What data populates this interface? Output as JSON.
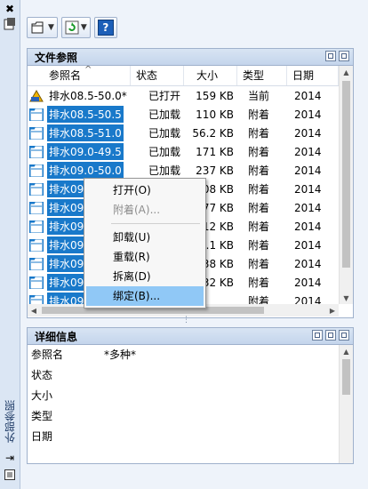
{
  "palette": {
    "title": "外部参照"
  },
  "file_refs": {
    "title": "文件参照",
    "columns": [
      "参照名",
      "状态",
      "大小",
      "类型",
      "日期"
    ],
    "rows": [
      {
        "name": "排水08.5-50.0*",
        "status": "已打开",
        "size": "159 KB",
        "type": "当前",
        "date": "2014",
        "selected": false,
        "icon": "dwg-current-icon"
      },
      {
        "name": "排水08.5-50.5",
        "status": "已加载",
        "size": "110 KB",
        "type": "附着",
        "date": "2014",
        "selected": true,
        "icon": "xref-icon"
      },
      {
        "name": "排水08.5-51.0",
        "status": "已加载",
        "size": "56.2 KB",
        "type": "附着",
        "date": "2014",
        "selected": true,
        "icon": "xref-icon"
      },
      {
        "name": "排水09.0-49.5",
        "status": "已加载",
        "size": "171 KB",
        "type": "附着",
        "date": "2014",
        "selected": true,
        "icon": "xref-icon"
      },
      {
        "name": "排水09.0-50.0",
        "status": "已加载",
        "size": "237 KB",
        "type": "附着",
        "date": "2014",
        "selected": true,
        "icon": "xref-icon"
      },
      {
        "name": "排水09",
        "status": "",
        "size": "08 KB",
        "type": "附着",
        "date": "2014",
        "selected": true,
        "icon": "xref-icon"
      },
      {
        "name": "排水09",
        "status": "",
        "size": "77 KB",
        "type": "附着",
        "date": "2014",
        "selected": true,
        "icon": "xref-icon"
      },
      {
        "name": "排水09",
        "status": "",
        "size": "12 KB",
        "type": "附着",
        "date": "2014",
        "selected": true,
        "icon": "xref-icon"
      },
      {
        "name": "排水09",
        "status": "",
        "size": "0.1 KB",
        "type": "附着",
        "date": "2014",
        "selected": true,
        "icon": "xref-icon"
      },
      {
        "name": "排水09",
        "status": "",
        "size": "38 KB",
        "type": "附着",
        "date": "2014",
        "selected": true,
        "icon": "xref-icon"
      },
      {
        "name": "排水09",
        "status": "",
        "size": "32 KB",
        "type": "附着",
        "date": "2014",
        "selected": true,
        "icon": "xref-icon"
      },
      {
        "name": "排水09",
        "status": "",
        "size": "",
        "type": "附着",
        "date": "2014",
        "selected": true,
        "icon": "xref-icon"
      }
    ]
  },
  "context_menu": {
    "items": [
      {
        "label": "打开(O)",
        "disabled": false,
        "hover": false
      },
      {
        "label": "附着(A)...",
        "disabled": true,
        "hover": false
      },
      {
        "sep": true
      },
      {
        "label": "卸载(U)",
        "disabled": false,
        "hover": false
      },
      {
        "label": "重载(R)",
        "disabled": false,
        "hover": false
      },
      {
        "label": "拆离(D)",
        "disabled": false,
        "hover": false
      },
      {
        "label": "绑定(B)...",
        "disabled": false,
        "hover": true
      }
    ]
  },
  "details": {
    "title": "详细信息",
    "rows": [
      {
        "label": "参照名",
        "value": "*多种*"
      },
      {
        "label": "状态",
        "value": ""
      },
      {
        "label": "大小",
        "value": ""
      },
      {
        "label": "类型",
        "value": ""
      },
      {
        "label": "日期",
        "value": ""
      }
    ]
  },
  "colors": {
    "selection": "#1979ca",
    "menu_hover": "#90c8f6"
  }
}
